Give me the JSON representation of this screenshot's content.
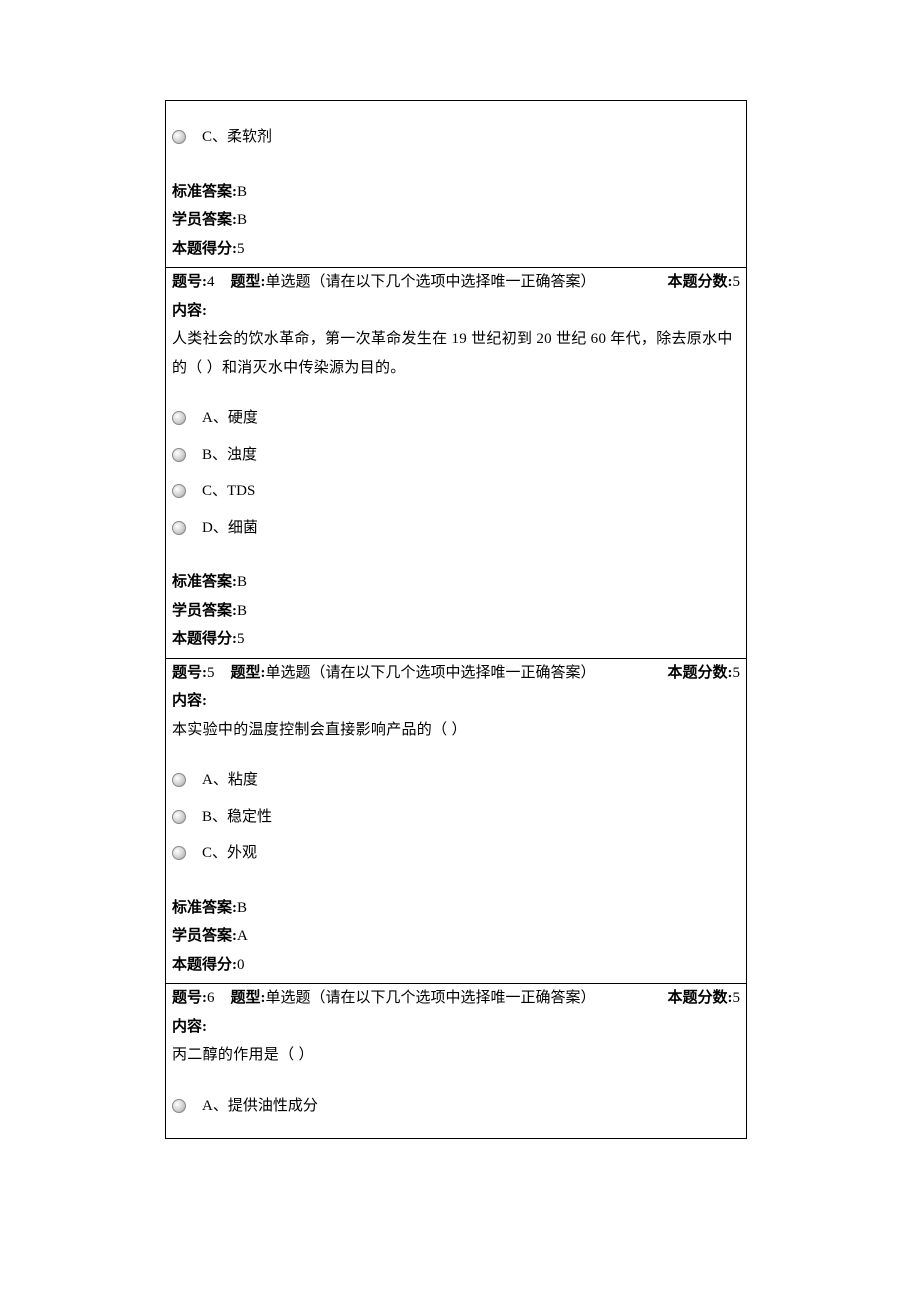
{
  "labels": {
    "qnum_prefix": "题号:",
    "qtype_prefix": "题型:",
    "score_prefix": "本题分数:",
    "content_label": "内容:",
    "std_ans": "标准答案:",
    "stu_ans": "学员答案:",
    "obtained": "本题得分:",
    "qtype_text": "单选题（请在以下几个选项中选择唯一正确答案）"
  },
  "questions": [
    {
      "number": "3",
      "total_score": "5",
      "stem": "",
      "options": [
        "C、柔软剂"
      ],
      "std_answer": "B",
      "stu_answer": "B",
      "obtained_score": "5",
      "show_header": false
    },
    {
      "number": "4",
      "total_score": "5",
      "stem": "人类社会的饮水革命，第一次革命发生在 19 世纪初到 20 世纪 60 年代，除去原水中的（ ）和消灭水中传染源为目的。",
      "options": [
        "A、硬度",
        "B、浊度",
        "C、TDS",
        "D、细菌"
      ],
      "std_answer": "B",
      "stu_answer": "B",
      "obtained_score": "5",
      "show_header": true
    },
    {
      "number": "5",
      "total_score": "5",
      "stem": "本实验中的温度控制会直接影响产品的（ ）",
      "options": [
        "A、粘度",
        "B、稳定性",
        "C、外观"
      ],
      "std_answer": "B",
      "stu_answer": "A",
      "obtained_score": "0",
      "show_header": true
    },
    {
      "number": "6",
      "total_score": "5",
      "stem": "丙二醇的作用是（ ）",
      "options": [
        "A、提供油性成分"
      ],
      "std_answer": "",
      "stu_answer": "",
      "obtained_score": "",
      "show_header": true,
      "truncated": true
    }
  ]
}
